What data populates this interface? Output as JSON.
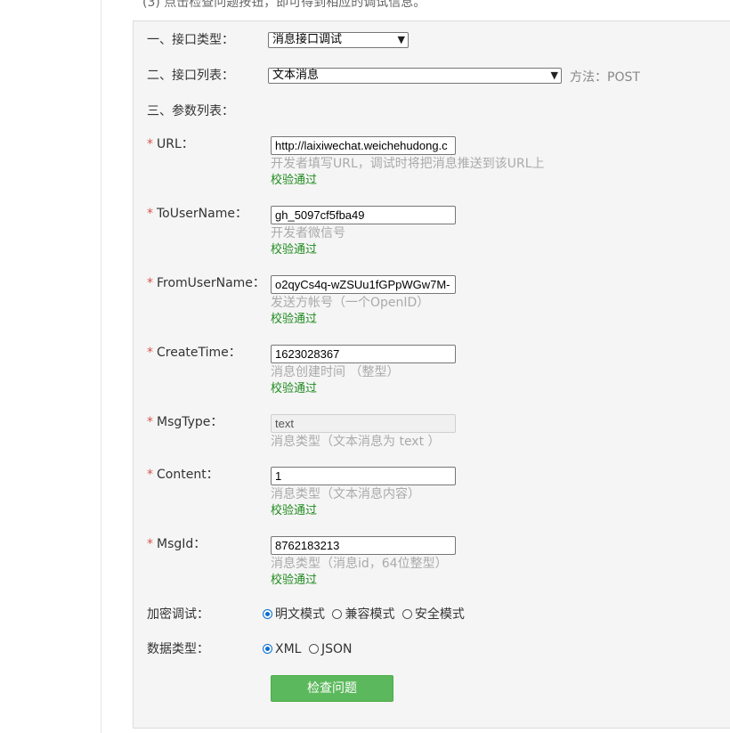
{
  "header": {
    "note": "(3) 点击检查问题按钮，即可得到相应的调试信息。"
  },
  "section1": {
    "label": "一、接口类型：",
    "select_value": "消息接口调试"
  },
  "section2": {
    "label": "二、接口列表：",
    "select_value": "文本消息",
    "method_label": "方法：POST"
  },
  "section3": {
    "label": "三、参数列表："
  },
  "fields": [
    {
      "required": "*",
      "label": "URL：",
      "value": "http://laixiwechat.weichehudong.c",
      "hint": "开发者填写URL，调试时将把消息推送到该URL上",
      "status": "校验通过"
    },
    {
      "required": "*",
      "label": "ToUserName：",
      "value": "gh_5097cf5fba49",
      "hint": "开发者微信号",
      "status": "校验通过"
    },
    {
      "required": "*",
      "label": "FromUserName：",
      "value": "o2qyCs4q-wZSUu1fGPpWGw7M-",
      "hint": "发送方帐号（一个OpenID）",
      "status": "校验通过"
    },
    {
      "required": "*",
      "label": "CreateTime：",
      "value": "1623028367",
      "hint": "消息创建时间 （整型）",
      "status": "校验通过"
    },
    {
      "required": "*",
      "label": "MsgType：",
      "value": "text",
      "hint": "消息类型（文本消息为 text ）",
      "status": ""
    },
    {
      "required": "*",
      "label": "Content：",
      "value": "1",
      "hint": "消息类型（文本消息内容）",
      "status": "校验通过"
    },
    {
      "required": "*",
      "label": "MsgId：",
      "value": "8762183213",
      "hint": "消息类型（消息id，64位整型）",
      "status": "校验通过"
    }
  ],
  "encryption": {
    "label": "加密调试：",
    "options": [
      "明文模式",
      "兼容模式",
      "安全模式"
    ],
    "selected": "明文模式"
  },
  "data_type": {
    "label": "数据类型：",
    "options": [
      "XML",
      "JSON"
    ],
    "selected": "XML"
  },
  "check_button": "检查问题",
  "colors": {
    "required": "#d9534f",
    "valid": "#1e8b1e",
    "button": "#5cb85c",
    "radio_selected": "#0a6ed1"
  },
  "icons": {
    "select_arrow": "chevron-down-icon",
    "radio_selected": "radio-selected-icon",
    "radio_unselected": "radio-unselected-icon"
  }
}
